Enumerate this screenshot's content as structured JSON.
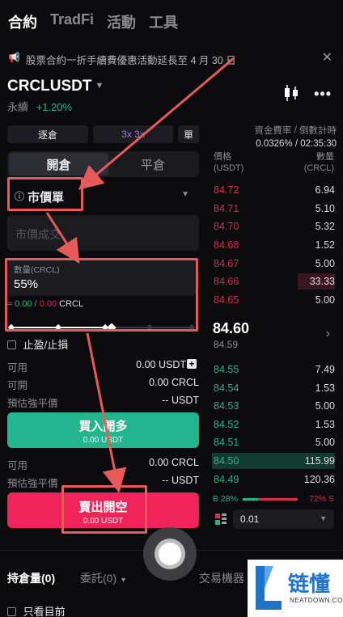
{
  "top_tabs": [
    "合約",
    "TradFi",
    "活動",
    "工具"
  ],
  "notice": {
    "text": "股票合約一折手續費優惠活動延長至 4 月 30 日"
  },
  "symbol": {
    "name": "CRCLUSDT",
    "type": "永續",
    "change": "+1.20%"
  },
  "funding": {
    "label": "資金費率 / 倒數計時",
    "value": "0.0326% / 02:35:30"
  },
  "controls": {
    "margin_mode": "逐倉",
    "leverage": "3x 3x",
    "mode_unit": "單"
  },
  "segment": {
    "open": "開倉",
    "close": "平倉"
  },
  "order_type": {
    "label": "市價單"
  },
  "price_field": {
    "placeholder": "市價成交"
  },
  "qty_field": {
    "label": "數量(CRCL)",
    "value": "55%",
    "approx": "≈ 0.00 / 0.00 CRCL",
    "approx_a": "0.00",
    "approx_b": "0.00",
    "unit": "CRCL"
  },
  "tpsl": {
    "label": "止盈/止損"
  },
  "info_buy": [
    {
      "label": "可用",
      "value": "0.00 USDT"
    },
    {
      "label": "可開",
      "value": "0.00 CRCL"
    },
    {
      "label": "預估強平價",
      "value": "-- USDT"
    }
  ],
  "buy_button": {
    "label": "買入開多",
    "sub": "0.00 USDT"
  },
  "info_sell": [
    {
      "label": "可用",
      "value": "0.00 CRCL"
    },
    {
      "label": "預估強平價",
      "value": "-- USDT"
    }
  ],
  "sell_button": {
    "label": "賣出開空",
    "sub": "0.00 USDT"
  },
  "orderbook": {
    "col_price": "價格",
    "col_price_unit": "(USDT)",
    "col_qty": "數量",
    "col_qty_unit": "(CRCL)",
    "asks": [
      {
        "price": "84.72",
        "qty": "6.94"
      },
      {
        "price": "84.71",
        "qty": "5.10"
      },
      {
        "price": "84.70",
        "qty": "5.32"
      },
      {
        "price": "84.68",
        "qty": "1.52"
      },
      {
        "price": "84.67",
        "qty": "5.00"
      },
      {
        "price": "84.66",
        "qty": "33.33"
      },
      {
        "price": "84.65",
        "qty": "5.00"
      }
    ],
    "last_price": "84.60",
    "mark_price": "84.59",
    "bids": [
      {
        "price": "84.55",
        "qty": "7.49"
      },
      {
        "price": "84.54",
        "qty": "1.53"
      },
      {
        "price": "84.53",
        "qty": "5.00"
      },
      {
        "price": "84.52",
        "qty": "1.53"
      },
      {
        "price": "84.51",
        "qty": "5.00"
      },
      {
        "price": "84.50",
        "qty": "115.99"
      },
      {
        "price": "84.49",
        "qty": "120.36"
      }
    ],
    "ratio_b": "B 28%",
    "ratio_s": "72% S",
    "ratio_b_fraction": 0.28,
    "precision": "0.01"
  },
  "bottom": {
    "positions": "持倉量(0)",
    "orders": "委託(0)",
    "bots": "交易機器",
    "only_current": "只看目前"
  },
  "logo": {
    "brand": "链懂",
    "domain": "NEATDOWN.COM"
  },
  "colors": {
    "green": "#23b58e",
    "red": "#e0294f",
    "annotation": "#e85a5a"
  }
}
